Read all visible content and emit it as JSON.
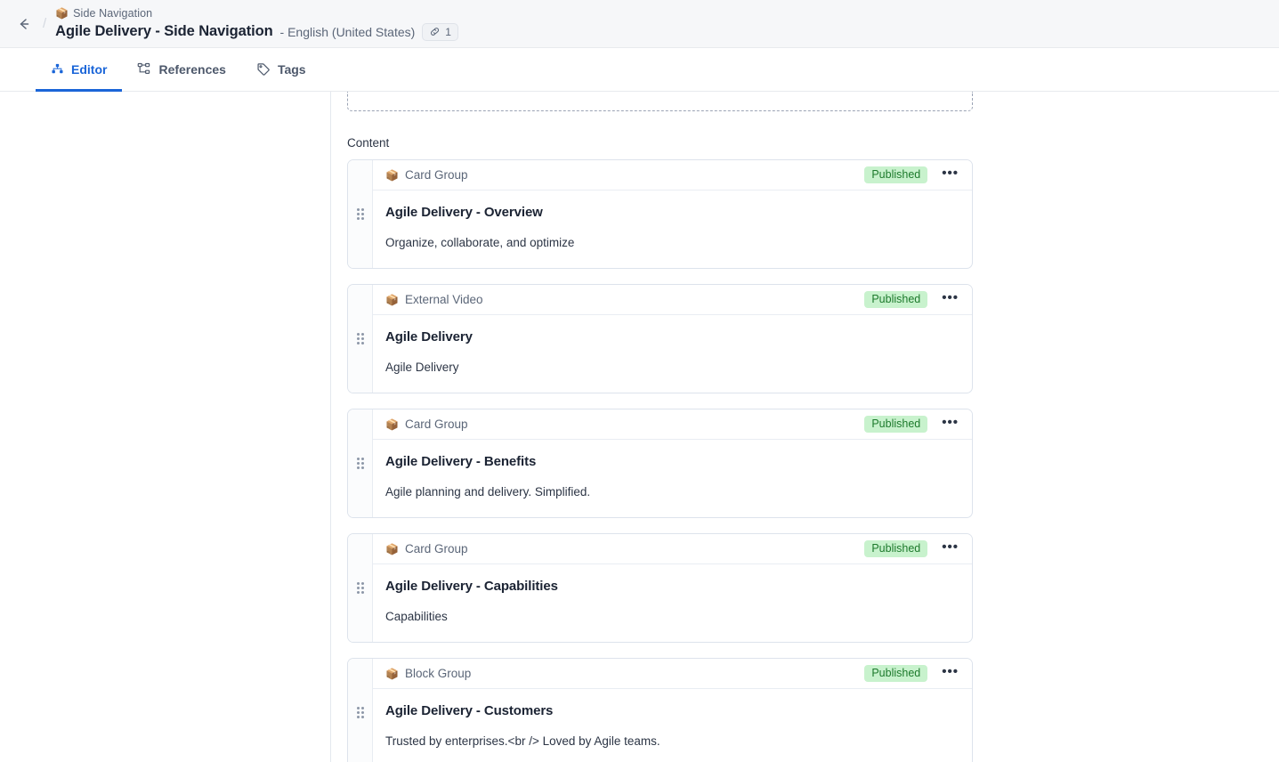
{
  "header": {
    "back_icon": "arrow-left-icon",
    "separator": "/",
    "breadcrumb_icon": "📦",
    "breadcrumb": "Side Navigation",
    "title": "Agile Delivery - Side Navigation",
    "locale": "- English (United States)",
    "link_badge": {
      "icon": "link-icon",
      "count": "1"
    }
  },
  "tabs": [
    {
      "label": "Editor",
      "icon": "hierarchy-dots-icon",
      "active": true
    },
    {
      "label": "References",
      "icon": "sitemap-icon",
      "active": false
    },
    {
      "label": "Tags",
      "icon": "tag-icon",
      "active": false
    }
  ],
  "main": {
    "section_label": "Content",
    "cards": [
      {
        "type_icon": "📦",
        "type": "Card Group",
        "status": "Published",
        "menu": "•••",
        "title": "Agile Delivery - Overview",
        "description": "Organize, collaborate, and optimize"
      },
      {
        "type_icon": "📦",
        "type": "External Video",
        "status": "Published",
        "menu": "•••",
        "title": "Agile Delivery",
        "description": "Agile Delivery"
      },
      {
        "type_icon": "📦",
        "type": "Card Group",
        "status": "Published",
        "menu": "•••",
        "title": "Agile Delivery - Benefits",
        "description": "Agile planning and delivery. Simplified."
      },
      {
        "type_icon": "📦",
        "type": "Card Group",
        "status": "Published",
        "menu": "•••",
        "title": "Agile Delivery - Capabilities",
        "description": "Capabilities"
      },
      {
        "type_icon": "📦",
        "type": "Block Group",
        "status": "Published",
        "menu": "•••",
        "title": "Agile Delivery - Customers",
        "description": "Trusted by enterprises.<br /> Loved by Agile teams."
      }
    ]
  },
  "colors": {
    "accent": "#1a65d8",
    "header_bg": "#f6f7f9",
    "badge_bg": "#c8f2cd",
    "badge_text": "#1d7a2c",
    "text_primary": "#1b2333",
    "text_muted": "#5b6678"
  }
}
